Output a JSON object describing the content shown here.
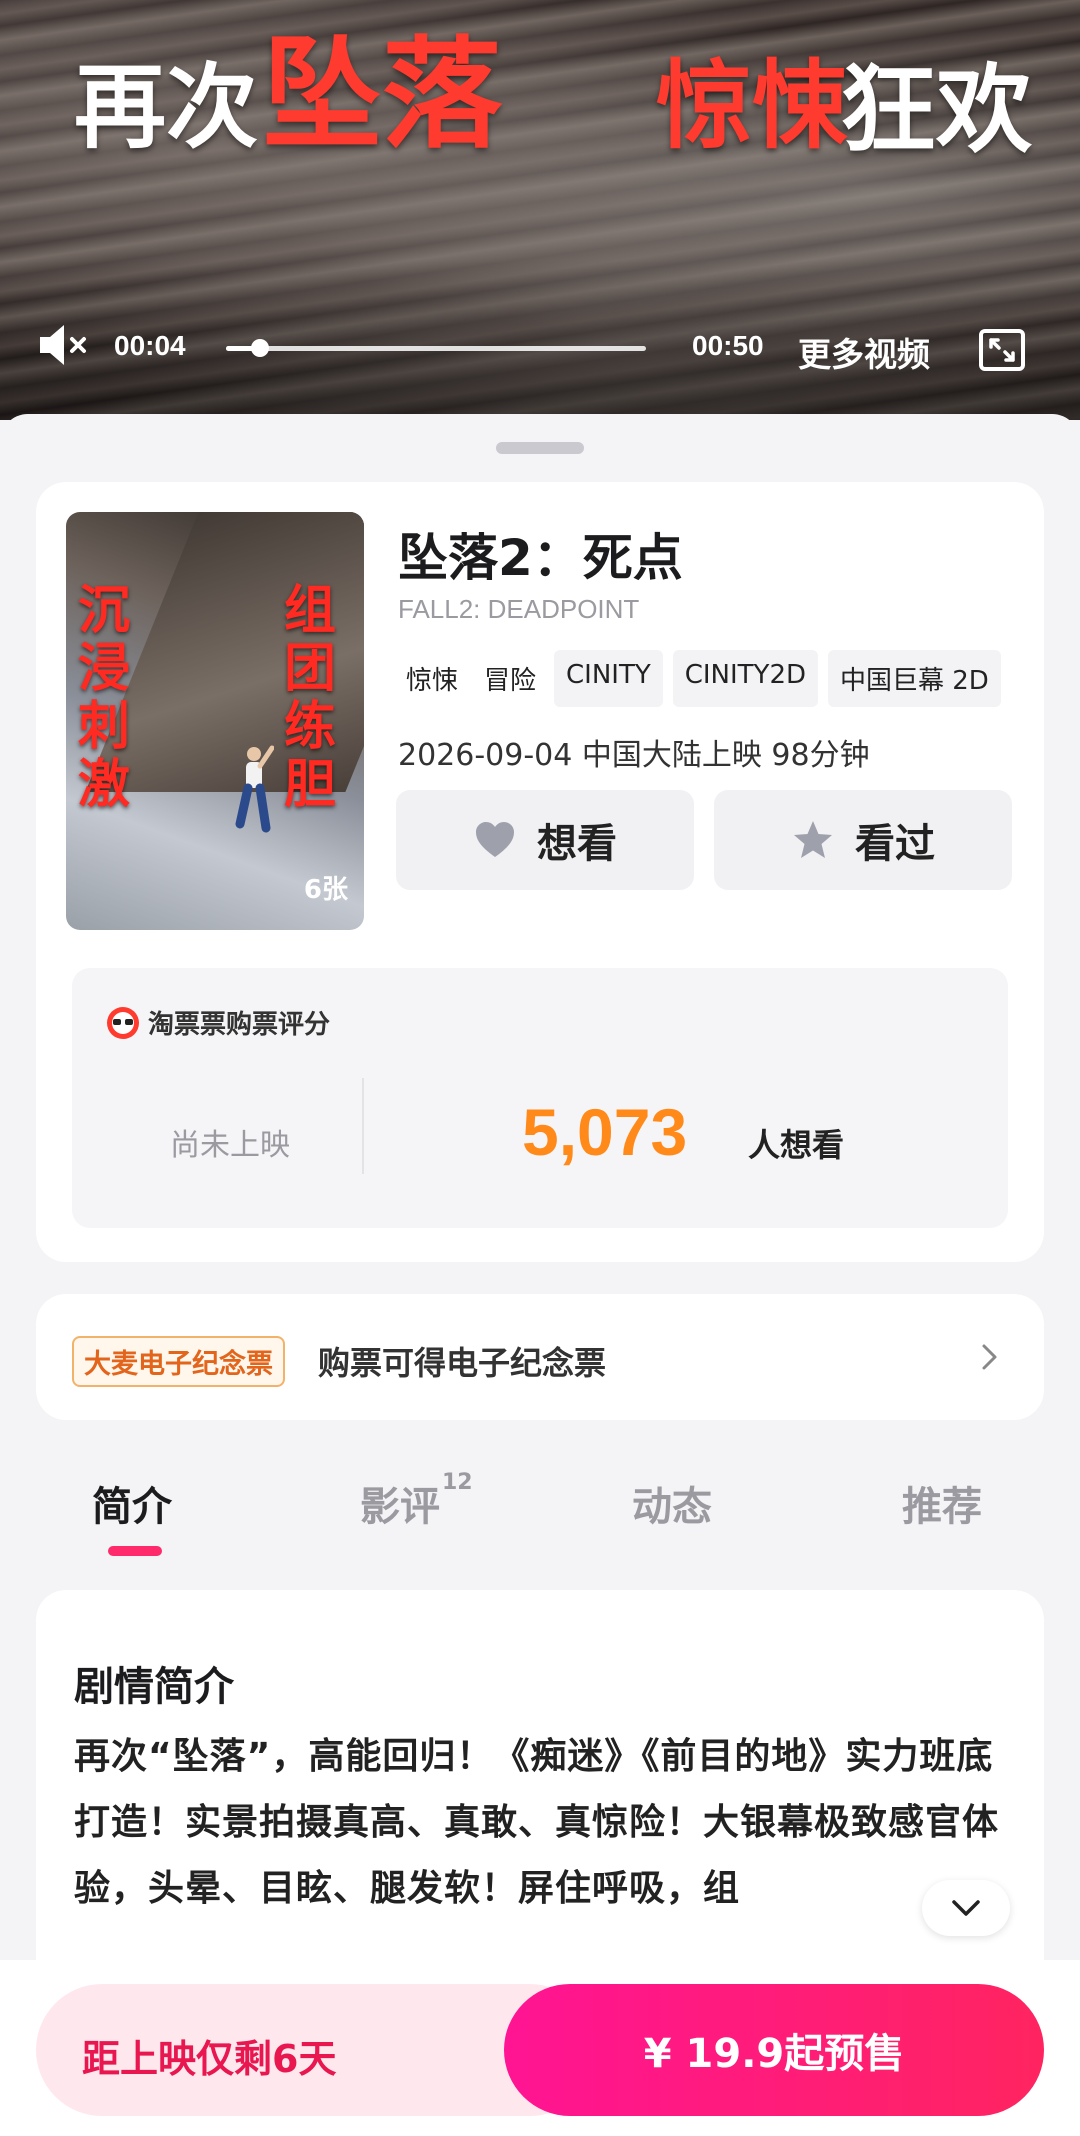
{
  "video": {
    "banner_word1": "再次",
    "banner_word2": "坠落",
    "banner_word3": "惊悚",
    "banner_word4": "狂欢",
    "current_time": "00:04",
    "duration": "00:50",
    "progress_fraction": 0.08,
    "more_videos_label": "更多视频"
  },
  "movie": {
    "title": "坠落2：死点",
    "english_title": "FALL2: DEADPOINT",
    "tags": [
      {
        "label": "惊悚",
        "boxed": false
      },
      {
        "label": "冒险",
        "boxed": false
      },
      {
        "label": "CINITY",
        "boxed": true
      },
      {
        "label": "CINITY2D",
        "boxed": true
      },
      {
        "label": "中国巨幕 2D",
        "boxed": true
      }
    ],
    "release_info": "2026-09-04 中国大陆上映 98分钟",
    "poster": {
      "left_text": "沉浸刺激",
      "right_text": "组团练胆",
      "image_count": "6张"
    },
    "want_button_label": "想看",
    "seen_button_label": "看过"
  },
  "rating": {
    "source_label": "淘票票购票评分",
    "status": "尚未上映",
    "want_count": "5,073",
    "want_suffix": "人想看"
  },
  "souvenir": {
    "badge": "大麦电子纪念票",
    "text": "购票可得电子纪念票"
  },
  "tabs": [
    {
      "label": "简介",
      "sup": "",
      "active": true
    },
    {
      "label": "影评",
      "sup": "12",
      "active": false
    },
    {
      "label": "动态",
      "sup": "",
      "active": false
    },
    {
      "label": "推荐",
      "sup": "",
      "active": false
    }
  ],
  "synopsis": {
    "title": "剧情简介",
    "body": "再次“坠落”，高能回归！《痴迷》《前目的地》实力班底打造！实景拍摄真高、真敢、真惊险！大银幕极致感官体验，头晕、目眩、腿发软！屏住呼吸，组"
  },
  "bottom": {
    "countdown": "距上映仅剩6天",
    "presale": "¥ 19.9起预售"
  },
  "colors": {
    "accent_pink": "#ff2a6b",
    "want_count_orange": "#ff8a1a",
    "banner_red": "#ff3a2e"
  }
}
